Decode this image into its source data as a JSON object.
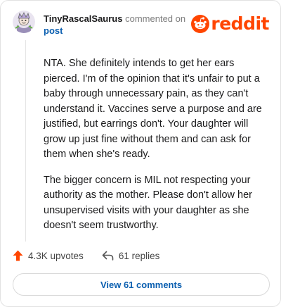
{
  "header": {
    "username": "TinyRascalSaurus",
    "action_text": "commented on",
    "post_link": "post"
  },
  "brand": {
    "wordmark": "reddit",
    "color": "#ff4500"
  },
  "comment": {
    "paragraphs": [
      "NTA. She definitely intends to get her ears pierced. I'm of the opinion that it's unfair to put a baby through unnecessary pain, as they can't understand it. Vaccines serve a purpose and are justified, but earrings don't. Your daughter will grow up just fine without them and can ask for them when she's ready.",
      "The bigger concern is MIL not respecting your authority as the mother. Please don't allow her unsupervised visits with your daughter as she doesn't seem trustworthy."
    ]
  },
  "actions": {
    "upvotes": "4.3K upvotes",
    "replies": "61 replies",
    "upvote_icon": "arrow-up-icon",
    "reply_icon": "reply-arrow-icon"
  },
  "footer": {
    "view_button": "View 61 comments"
  },
  "colors": {
    "link": "#0b5fb0",
    "accent": "#ff4500",
    "muted": "#7c7c7c"
  }
}
